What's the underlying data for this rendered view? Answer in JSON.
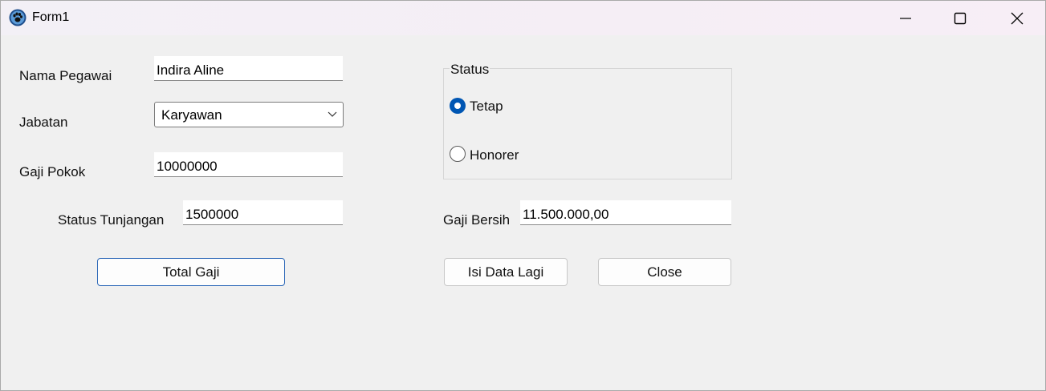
{
  "window": {
    "title": "Form1",
    "icon": "paw-icon",
    "controls": [
      "minimize-icon",
      "maximize-icon",
      "close-icon"
    ]
  },
  "form": {
    "nama_pegawai": {
      "label": "Nama Pegawai",
      "value": "Indira Aline"
    },
    "jabatan": {
      "label": "Jabatan",
      "selected": "Karyawan"
    },
    "gaji_pokok": {
      "label": "Gaji Pokok",
      "value": "10000000"
    },
    "status_tunjangan": {
      "label": "Status Tunjangan",
      "value": "1500000"
    },
    "status_group": {
      "title": "Status",
      "options": [
        {
          "label": "Tetap",
          "checked": true
        },
        {
          "label": "Honorer",
          "checked": false
        }
      ]
    },
    "gaji_bersih": {
      "label": "Gaji Bersih",
      "value": "11.500.000,00"
    }
  },
  "buttons": {
    "total_gaji": "Total Gaji",
    "isi_data_lagi": "Isi Data Lagi",
    "close": "Close"
  },
  "colors": {
    "accent": "#0056b3",
    "default_button_border": "#2d68b8",
    "form_background": "#f0f0f0"
  }
}
